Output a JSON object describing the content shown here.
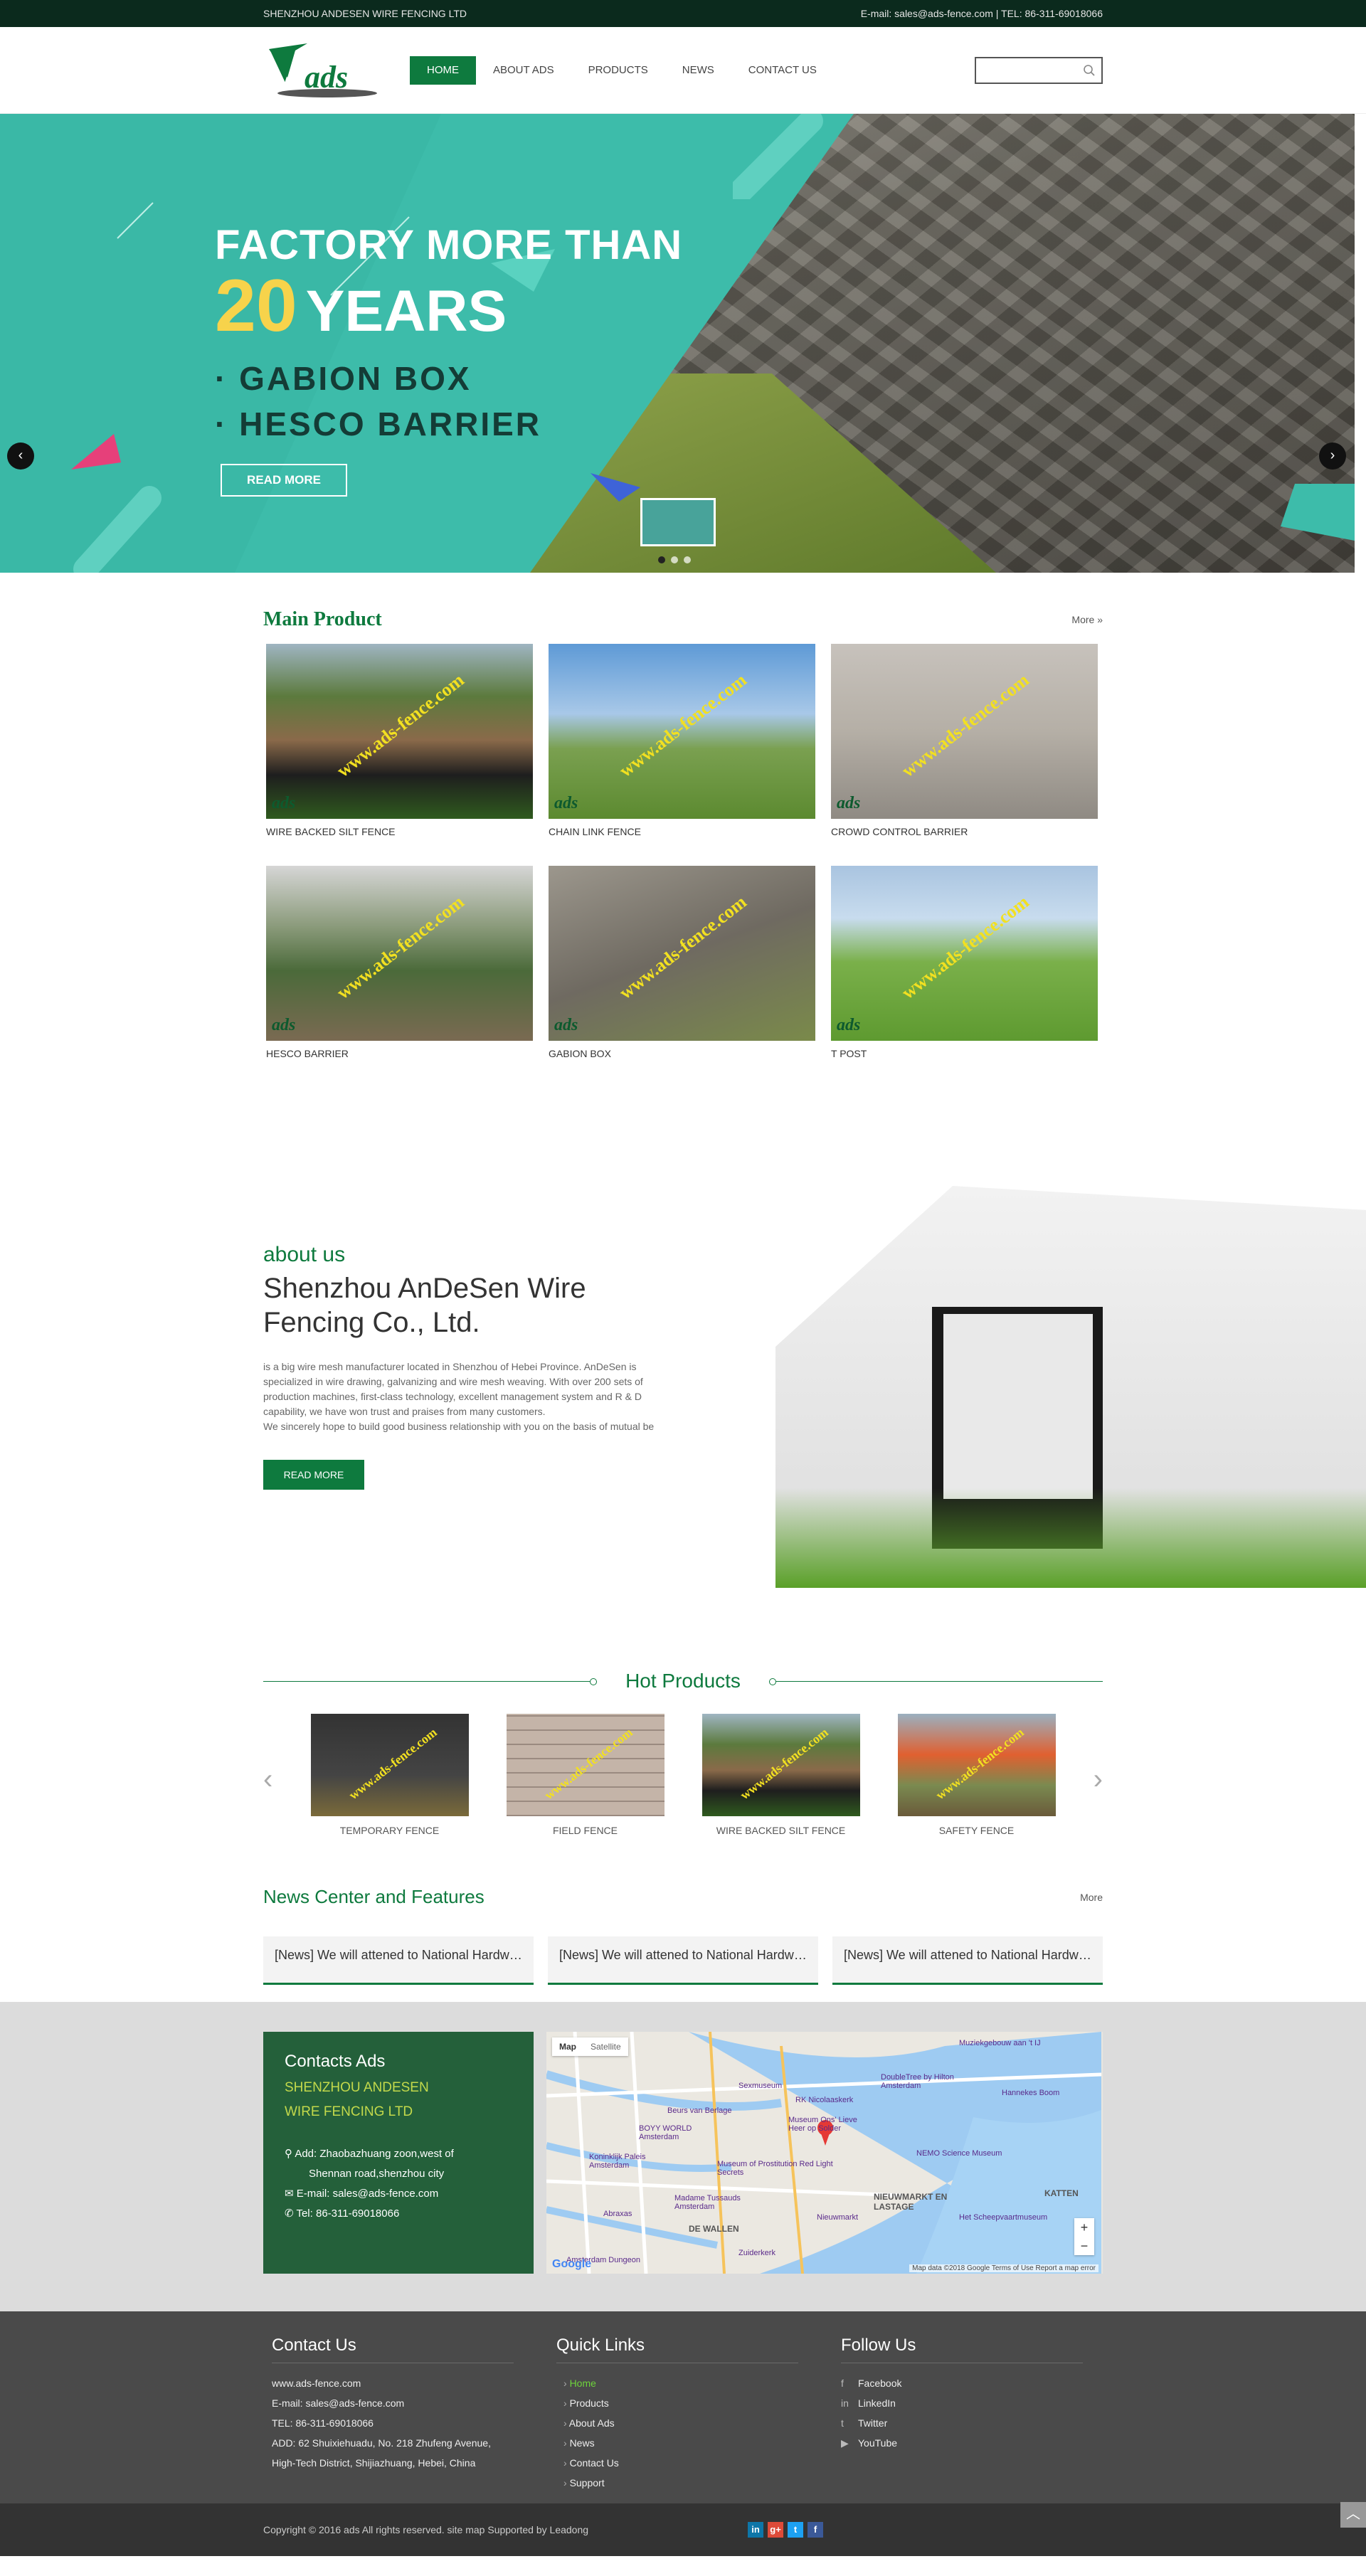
{
  "topbar": {
    "company": "SHENZHOU ANDESEN WIRE FENCING LTD",
    "contact": "E-mail: sales@ads-fence.com   |   TEL: 86-311-69018066"
  },
  "logo": {
    "text": "ads"
  },
  "nav": [
    {
      "label": "HOME",
      "active": true
    },
    {
      "label": "ABOUT ADS"
    },
    {
      "label": "PRODUCTS"
    },
    {
      "label": "NEWS"
    },
    {
      "label": "CONTACT US"
    }
  ],
  "search": {
    "placeholder": ""
  },
  "banner": {
    "line1": "FACTORY MORE THAN",
    "num": "20",
    "years": "YEARS",
    "items": [
      "· GABION BOX",
      "· HESCO BARRIER"
    ],
    "button": "READ MORE",
    "prev": "‹",
    "next": "›"
  },
  "main_product": {
    "title": "Main Product",
    "more": "More »",
    "items": [
      {
        "label": "WIRE BACKED SILT FENCE"
      },
      {
        "label": "CHAIN LINK FENCE"
      },
      {
        "label": "CROWD CONTROL BARRIER"
      },
      {
        "label": "HESCO BARRIER"
      },
      {
        "label": "GABION BOX"
      },
      {
        "label": "T POST"
      }
    ],
    "watermark": "www.ads-fence.com",
    "minilogo": "ads"
  },
  "about": {
    "label": "about us",
    "title": "Shenzhou AnDeSen Wire Fencing Co., Ltd.",
    "p1": "is a big wire mesh manufacturer located in Shenzhou of Hebei Province. AnDeSen is specialized in wire drawing, galvanizing and wire mesh weaving. With over 200 sets of production machines, first-class technology, excellent management system and R & D capability, we have won trust and praises from many customers.",
    "p2": "We sincerely hope to build good business relationship with you on the basis of mutual be",
    "button": "READ MORE"
  },
  "hot": {
    "title": "Hot Products",
    "prev": "‹",
    "next": "›",
    "items": [
      {
        "label": "TEMPORARY FENCE"
      },
      {
        "label": "FIELD FENCE"
      },
      {
        "label": "WIRE BACKED SILT FENCE"
      },
      {
        "label": "SAFETY FENCE"
      }
    ]
  },
  "news": {
    "title": "News Center and Features",
    "more": "More",
    "items": [
      "[News] We will attened to National Hardware Show",
      "[News] We will attened to National Hardware Show",
      "[News] We will attened to National Hardware Show"
    ]
  },
  "contact": {
    "title": "Contacts Ads",
    "company_line1": "SHENZHOU ANDESEN",
    "company_line2": "WIRE FENCING LTD",
    "addr1": "Add: Zhaobazhuang zoon,west of",
    "addr2": "Shennan road,shenzhou city",
    "email": "E-mail: sales@ads-fence.com",
    "tel": "Tel: 86-311-69018066"
  },
  "map": {
    "tab1": "Map",
    "tab2": "Satellite",
    "labels": [
      "Muziekgebouw aan 't IJ",
      "DoubleTree by Hilton Amsterdam",
      "Sexmuseum",
      "Beurs van Berlage",
      "Museum Ons' Lieve Heer op Solder",
      "Koninklijk Paleis Amsterdam",
      "Museum of Prostitution Red Light Secrets",
      "Madame Tussauds Amsterdam",
      "NEMO Science Museum",
      "Het Scheepvaartmuseum",
      "NIEUWMARKT EN LASTAGE",
      "DE WALLEN",
      "Abraxas",
      "Amsterdam Dungeon",
      "Zuiderkerk",
      "Hannekes Boom",
      "KATTEN",
      "RK Nicolaaskerk",
      "BOYY WORLD Amsterdam",
      "Nieuwmarkt"
    ],
    "footer": "Map data ©2018 Google   Terms of Use   Report a map error",
    "google": "Google",
    "zoom_in": "+",
    "zoom_out": "−"
  },
  "footer": {
    "c1": {
      "title": "Contact Us",
      "rows": [
        "www.ads-fence.com",
        "E-mail: sales@ads-fence.com",
        "TEL: 86-311-69018066",
        "ADD: 62 Shuixiehuadu, No. 218 Zhufeng Avenue,",
        "High-Tech District, Shijiazhuang, Hebei, China"
      ]
    },
    "c2": {
      "title": "Quick Links",
      "rows": [
        "Home",
        "Products",
        "About Ads",
        "News",
        "Contact Us",
        "Support"
      ]
    },
    "c3": {
      "title": "Follow Us",
      "rows": [
        {
          "icon": "f",
          "label": "Facebook"
        },
        {
          "icon": "in",
          "label": "LinkedIn"
        },
        {
          "icon": "t",
          "label": "Twitter"
        },
        {
          "icon": "▶",
          "label": "YouTube"
        }
      ]
    }
  },
  "copyright": {
    "text": "Copyright  ©  2016  ads All rights reserved.   site map   Supported by Leadong",
    "social": [
      "in",
      "g+",
      "t",
      "f"
    ],
    "totop": "︿"
  }
}
